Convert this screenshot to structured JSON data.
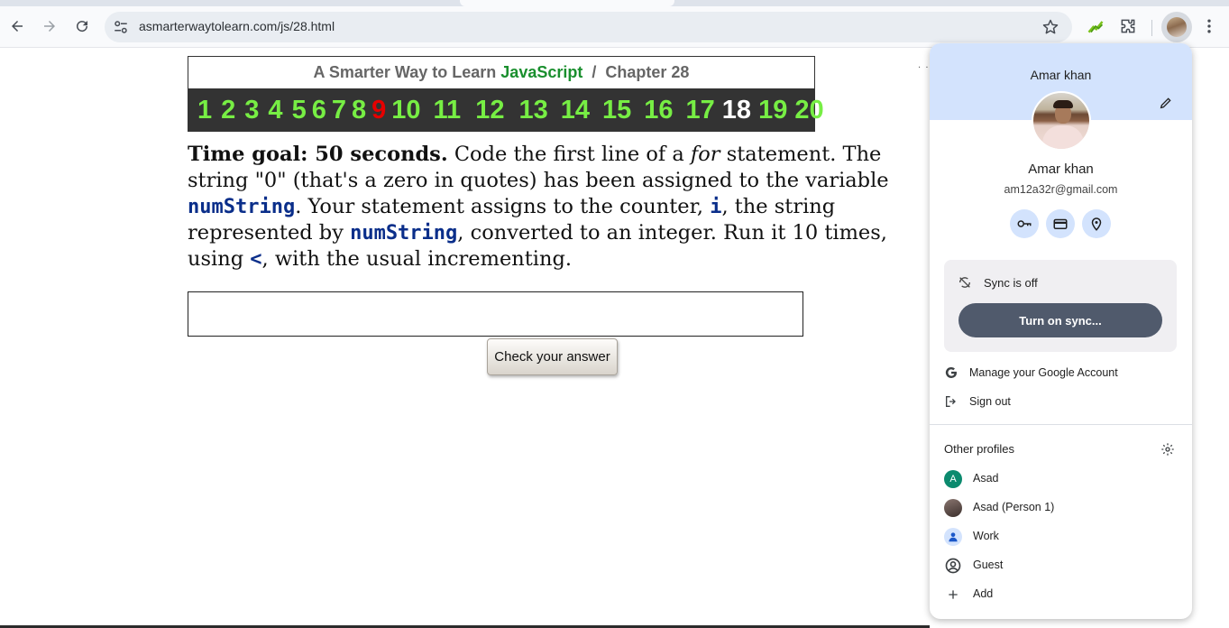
{
  "browser": {
    "url": "asmarterwaytolearn.com/js/28.html"
  },
  "page": {
    "header": {
      "prefix": "A Smarter Way to Learn",
      "brand": "JavaScript",
      "separator": "/",
      "chapter": "Chapter 28"
    },
    "chapters": [
      "1",
      "2",
      "3",
      "4",
      "5",
      "6",
      "7",
      "8",
      "9",
      "10",
      "11",
      "12",
      "13",
      "14",
      "15",
      "16",
      "17",
      "18",
      "19",
      "20"
    ],
    "current_chapter": "9",
    "visited_chapter": "18",
    "prompt": {
      "goal": "Time goal: 50 seconds.",
      "t1": " Code the first line of a ",
      "t2": "for",
      "t3": " statement. The string \"0\" (that's a zero in quotes) has been assigned to the variable ",
      "code1": "numString",
      "t4": ". Your statement assigns to the counter, ",
      "code2": "i",
      "t5": ", the string represented by ",
      "code3": "numString",
      "t6": ", converted to an integer. Run it 10 times, using ",
      "code4": "<",
      "t7": ", with the usual incrementing."
    },
    "answer_value": "",
    "check_button": "Check your answer",
    "dots": "· · ·"
  },
  "profile_menu": {
    "header_name": "Amar khan",
    "name": "Amar khan",
    "email": "am12a32r@gmail.com",
    "quick_actions": [
      "key-icon",
      "card-icon",
      "location-icon"
    ],
    "sync_status": "Sync is off",
    "sync_button": "Turn on sync...",
    "manage_account": "Manage your Google Account",
    "sign_out": "Sign out",
    "other_profiles_title": "Other profiles",
    "profiles": [
      {
        "label": "Asad",
        "initial": "A",
        "color": "#0b8a6e"
      },
      {
        "label": "Asad (Person 1)",
        "initial": "",
        "color": "#6b5a55"
      },
      {
        "label": "Work",
        "initial": "",
        "color": "#d3e3fd"
      },
      {
        "label": "Guest",
        "initial": "",
        "color": "#ffffff"
      },
      {
        "label": "Add",
        "initial": "",
        "color": "#ffffff"
      }
    ]
  },
  "colors": {
    "chapter_link": "#77ee44",
    "chapter_current": "#e60000",
    "brand_green": "#1a8f2e",
    "menu_header": "#d3e3fd",
    "sync_button": "#505a6c"
  }
}
